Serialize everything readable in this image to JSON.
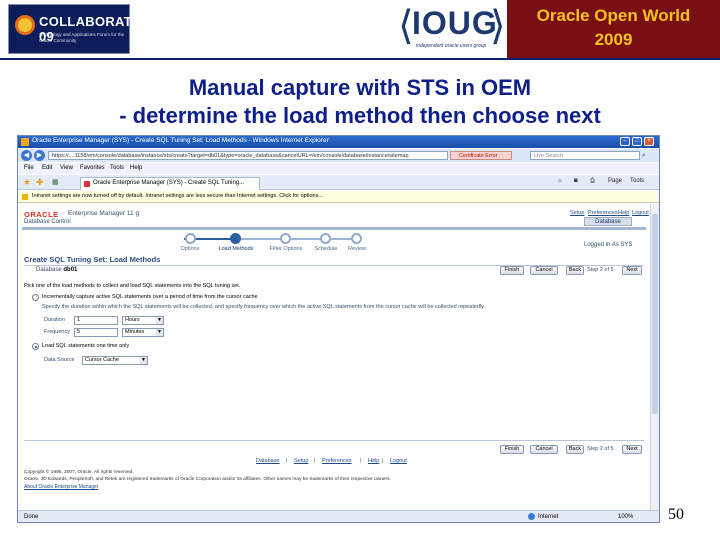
{
  "slide": {
    "collaborate_logo": "COLLABORATE 09",
    "collaborate_tagline": "Technology and Applications Forum for the Oracle Community",
    "ioug_logo": "IOUG",
    "ioug_tagline": "independent oracle users group",
    "event_line1": "Oracle Open World",
    "event_line2": "2009",
    "title_line1": "Manual capture with STS in OEM",
    "title_line2": "- determine the load method then choose next",
    "page_number": "50"
  },
  "browser": {
    "window_title": "Oracle Enterprise Manager (SYS) - Create SQL Tuning Set: Load Methods - Windows Internet Explorer",
    "url": "https://...:1158/em/console/database/instance/sts/create?target=db01&type=oracle_database&cancelURL=/em/console/database/instance/sitemap",
    "cert_error": "Certificate Error",
    "search_placeholder": "Live Search",
    "menu": [
      "File",
      "Edit",
      "View",
      "Favorites",
      "Tools",
      "Help"
    ],
    "tab_title": "Oracle Enterprise Manager (SYS) - Create SQL Tuning...",
    "command_items": [
      "Page",
      "Tools"
    ],
    "infobar_text": "Intranet settings are now turned off by default. Intranet settings are less secure than Internet settings. Click for options...",
    "status_done": "Done",
    "status_zone": "Internet",
    "status_zoom": "100%"
  },
  "em": {
    "oracle_logo": "ORACLE",
    "product": "Enterprise Manager 11 g",
    "subproduct": "Database Control",
    "top_links": [
      "Setup",
      "Preferences",
      "Help",
      "Logout"
    ],
    "db_tab": "Database",
    "logged_in": "Logged in As SYS",
    "steps": [
      {
        "label": "Options",
        "active": false
      },
      {
        "label": "Load Methods",
        "active": true
      },
      {
        "label": "Filter Options",
        "active": false
      },
      {
        "label": "Schedule",
        "active": false
      },
      {
        "label": "Review",
        "active": false
      }
    ],
    "page_title": "Create SQL Tuning Set: Load Methods",
    "database_label": "Database",
    "database_value": "db01",
    "buttons": {
      "finish": "Finish",
      "cancel": "Cancel",
      "back": "Back",
      "step_of": "Step 2 of 5",
      "next": "Next"
    },
    "instruction": "Pick one of the load methods to collect and load SQL statements into the SQL tuning set.",
    "option_incremental": {
      "label": "Incrementally capture active SQL statements over a period of time from the cursor cache",
      "selected": false,
      "desc": "Specify the duration within which the SQL statements will be collected, and specify frequency over which the active SQL statements from the cursor cache will be collected repeatedly.",
      "duration_label": "Duration",
      "duration_value": "1",
      "duration_unit": "Hours",
      "frequency_label": "Frequency",
      "frequency_value": "5",
      "frequency_unit": "Minutes"
    },
    "option_onetime": {
      "label": "Load SQL statements one time only",
      "selected": true,
      "source_label": "Data Source",
      "source_value": "Cursor Cache"
    },
    "footer_links": [
      "Database",
      "Setup",
      "Preferences",
      "Help",
      "Logout"
    ],
    "copyright_1": "Copyright © 1996, 2007, Oracle. All rights reserved.",
    "copyright_2": "Oracle, JD Edwards, PeopleSoft, and Retek are registered trademarks of Oracle Corporation and/or its affiliates. Other names may be trademarks of their respective owners.",
    "about_link": "About Oracle Enterprise Manager"
  }
}
